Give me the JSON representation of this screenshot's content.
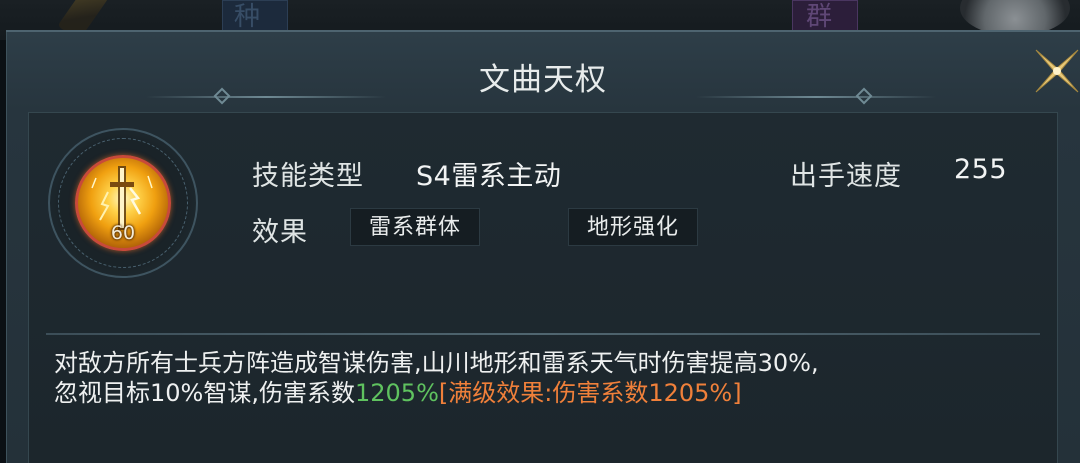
{
  "dialog": {
    "title": "文曲天权",
    "close_icon": "close-x-icon"
  },
  "background": {
    "card_left_char": "种",
    "card_right_char": "群"
  },
  "skill": {
    "icon": "lightning-sword-icon",
    "level": "60",
    "type_label": "技能类型",
    "type_value": "S4雷系主动",
    "speed_label": "出手速度",
    "speed_value": "255",
    "effect_label": "效果",
    "tags": [
      "雷系群体",
      "地形强化"
    ]
  },
  "description": {
    "line1": "对敌方所有士兵方阵造成智谋伤害,山川地形和雷系天气时伤害提高30%,",
    "line2_prefix": "忽视目标10%智谋,伤害系数",
    "line2_value": "1205%",
    "line2_max": "[满级效果:伤害系数1205%]"
  },
  "colors": {
    "highlight_green": "#5fc25f",
    "highlight_orange": "#f0803a",
    "icon_border_red": "#c84a3a",
    "close_gold": "#e8c878"
  }
}
